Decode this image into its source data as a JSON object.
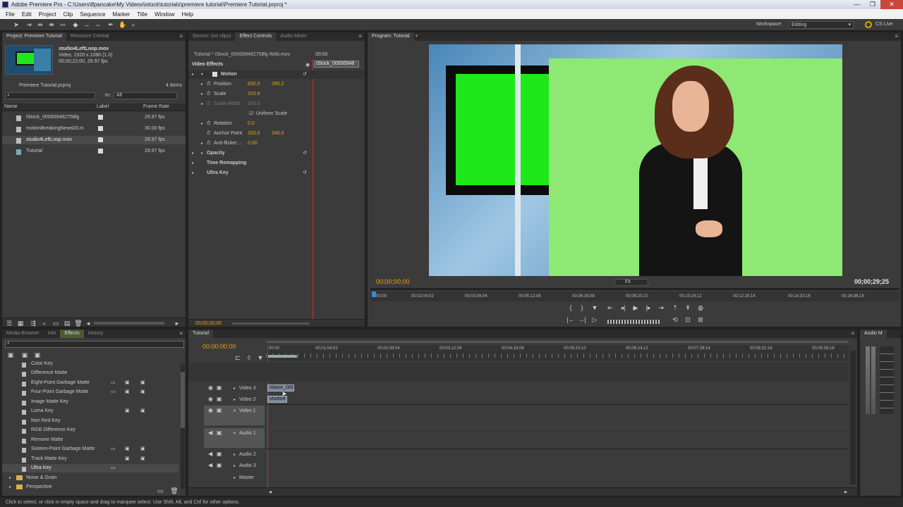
{
  "window": {
    "title": "Adobe Premiere Pro - C:\\Users\\lfpancake\\My Videos\\istock\\tutorials\\premiere tutorial\\Premiere Tutorial.prproj *",
    "controls": [
      "—",
      "❐",
      "✕"
    ]
  },
  "menu": [
    "File",
    "Edit",
    "Project",
    "Clip",
    "Sequence",
    "Marker",
    "Title",
    "Window",
    "Help"
  ],
  "workspace": {
    "label": "Workspace:",
    "value": "Editing",
    "cs_live": "CS Live"
  },
  "project": {
    "tabs": [
      "Project: Premiere Tutorial",
      "Resource Central"
    ],
    "clip_name": "studio4LeftLoop.mov",
    "clip_info": [
      "Video, 1920 x 1080 (1.0)",
      "00;00;22;00, 29.97 fps"
    ],
    "project_file": "Premiere Tutorial.prproj",
    "items_count": "4 Items",
    "in_label": "In:",
    "in_value": "All",
    "columns": [
      "Name",
      "Label",
      "Frame Rate"
    ],
    "rows": [
      {
        "name": "iStock_000009482758lg",
        "fps": "29.97 fps"
      },
      {
        "name": "motionBreakingNews03.m",
        "fps": "30.00 fps"
      },
      {
        "name": "studio4LeftLoop.mov",
        "fps": "29.97 fps"
      },
      {
        "name": "Tutorial",
        "fps": "29.97 fps"
      }
    ]
  },
  "effect_controls": {
    "tabs": [
      "Source: (no clips)",
      "Effect Controls",
      "Audio Mixer: "
    ],
    "header": "Tutorial * iStock_000009482758lg Web.mov",
    "mini_clip": "iStock_00000948",
    "mini_ruler": "00;00",
    "section": "Video Effects",
    "motion": "Motion",
    "position": {
      "label": "Position",
      "x": "832.0",
      "y": "285.2"
    },
    "scale": {
      "label": "Scale",
      "value": "153.8"
    },
    "scale_width": {
      "label": "Scale Width",
      "value": "100.0"
    },
    "uniform_scale": "Uniform Scale",
    "rotation": {
      "label": "Rotation",
      "value": "0.0"
    },
    "anchor": {
      "label": "Anchor Point",
      "x": "320.0",
      "y": "240.0"
    },
    "antiflicker": {
      "label": "Anti-flicker ...",
      "value": "0.00"
    },
    "opacity": "Opacity",
    "time_remap": "Time Remapping",
    "ultra_key": "Ultra Key",
    "timecode": "00;00;00;00"
  },
  "program": {
    "tab": "Program: Tutorial",
    "timecode_left": "00;00;00;00",
    "timecode_right": "00;00;29;25",
    "fit": "Fit",
    "ruler": [
      "00;00",
      "00;02;04;02",
      "00;03;08;04",
      "00;05;12;06",
      "00;06;16;08",
      "00;08;20;10",
      "00;10;24;12",
      "00;12;28;14",
      "00;14;32;16",
      "00;16;36;18"
    ]
  },
  "effects": {
    "tabs": [
      "Media Browser",
      "Info",
      "Effects",
      "History"
    ],
    "items": [
      "Color Key",
      "Difference Matte",
      "Eight-Point Garbage Matte",
      "Four-Point Garbage Matte",
      "Image Matte Key",
      "Luma Key",
      "Non Red Key",
      "RGB Difference Key",
      "Remove Matte",
      "Sixteen-Point Garbage Matte",
      "Track Matte Key",
      "Ultra Key"
    ],
    "folders": [
      "Noise & Grain",
      "Perspective"
    ]
  },
  "timeline": {
    "tab": "Tutorial",
    "timecode": "00:00:00:00",
    "ruler": [
      "00;00",
      "00;01;04;02",
      "00;02;08;04",
      "00;03;12;06",
      "00;04;16;08",
      "00;05;20;10",
      "00;06;24;12",
      "00;07;28;14",
      "00;08;32;16",
      "00;09;36;18"
    ],
    "tracks": [
      "Video 3",
      "Video 2",
      "Video 1",
      "Audio 1",
      "Audio 2",
      "Audio 3",
      "Master"
    ],
    "clip_v3": "iStock_000",
    "clip_v2": "studio4"
  },
  "audio_meters": {
    "tab": "Audio M"
  },
  "status": "Click to select, or click in empty space and drag to marquee select. Use Shift, Alt, and Ctrl for other options.",
  "colors": {
    "accent_orange": "#e8a40a",
    "green_screen": "#8de874",
    "bright_green": "#1ee81a",
    "playhead": "#d22b2b"
  }
}
